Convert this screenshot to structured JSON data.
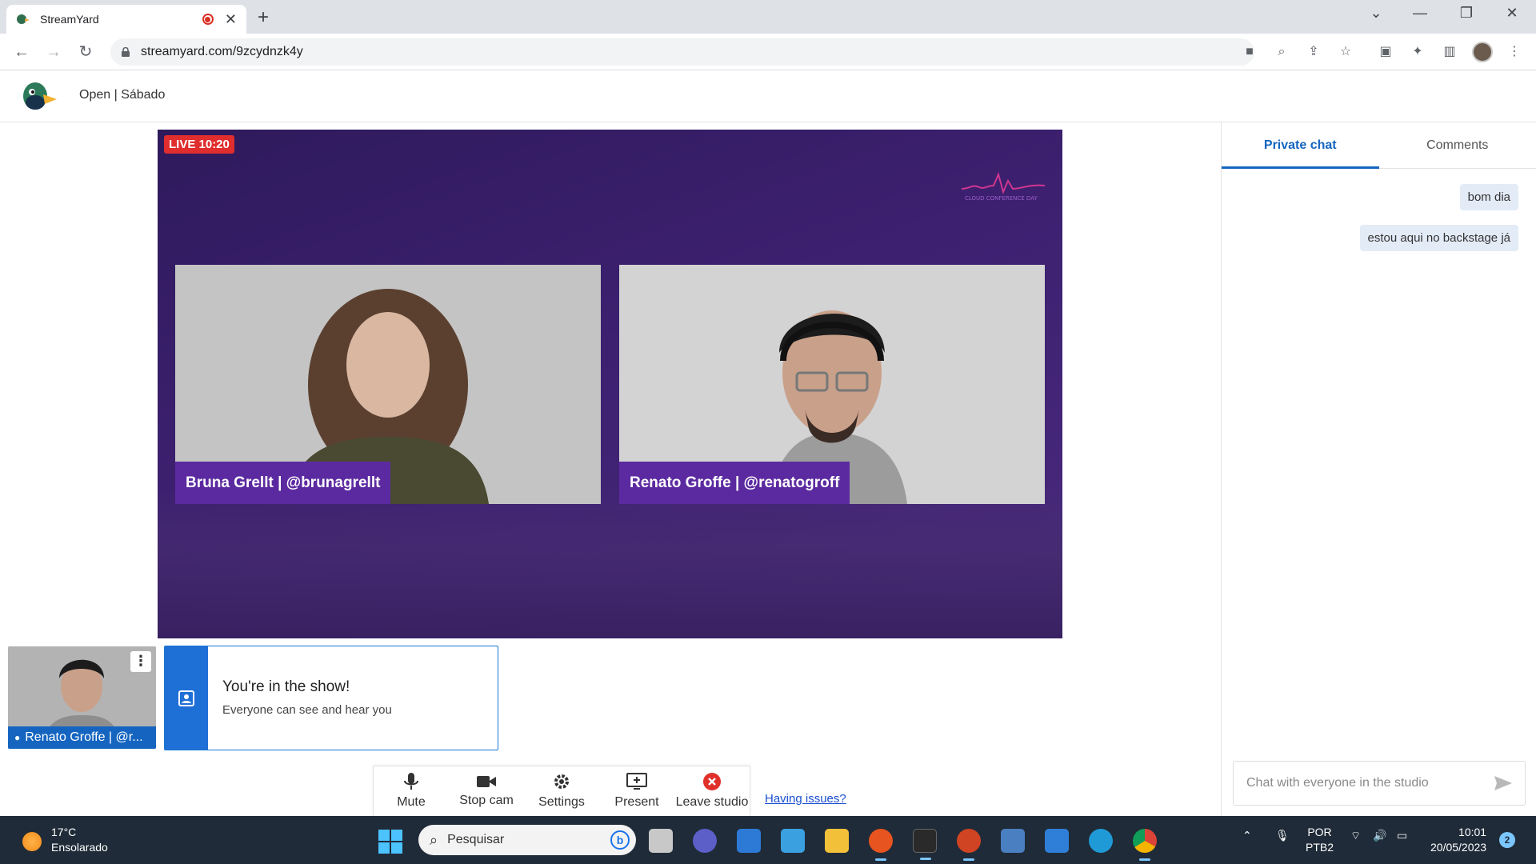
{
  "browser": {
    "tab_title": "StreamYard",
    "url": "streamyard.com/9zcydnzk4y"
  },
  "app": {
    "studio_title": "Open | Sábado"
  },
  "stage": {
    "live_badge": "LIVE 10:20",
    "brand_text": "CLOUD CONFERENCE DAY",
    "participants": [
      {
        "name_tag": "Bruna Grellt | @brunagrellt"
      },
      {
        "name_tag": "Renato Groffe | @renatogroff"
      }
    ]
  },
  "self_view": {
    "label": "Renato Groffe | @r..."
  },
  "banner": {
    "title": "You're in the show!",
    "subtitle": "Everyone can see and hear you"
  },
  "controls": {
    "mute": "Mute",
    "stop_cam": "Stop cam",
    "settings": "Settings",
    "present": "Present",
    "leave": "Leave studio",
    "issues_link": "Having issues?"
  },
  "chat": {
    "tabs": [
      "Private chat",
      "Comments"
    ],
    "messages": [
      "bom dia",
      "estou aqui no backstage já"
    ],
    "input_placeholder": "Chat with everyone in the studio"
  },
  "taskbar": {
    "weather_temp": "17°C",
    "weather_desc": "Ensolarado",
    "search_placeholder": "Pesquisar",
    "lang_1": "POR",
    "lang_2": "PTB2",
    "time": "10:01",
    "date": "20/05/2023",
    "notifications": "2"
  },
  "colors": {
    "accent": "#1565c0",
    "stage_bg": "#3d2070",
    "name_tag_bg": "#5b2aa0",
    "live_red": "#e02d2d"
  }
}
